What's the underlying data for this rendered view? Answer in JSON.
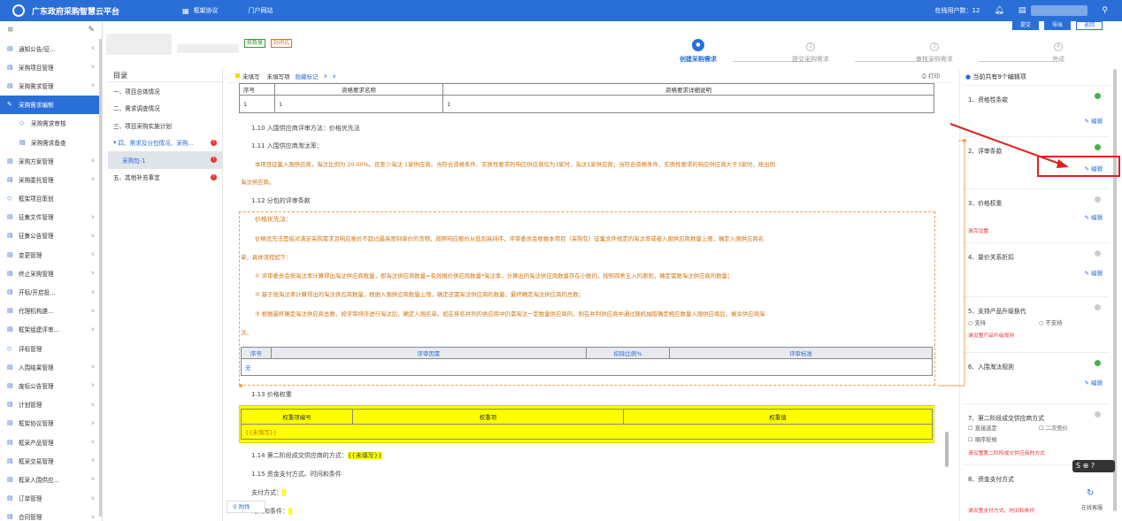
{
  "header": {
    "title": "广东政府采购智慧云平台",
    "nav": [
      {
        "icon": "grid-icon",
        "label": "框架协议"
      },
      {
        "icon": "none",
        "label": "门户网站"
      }
    ],
    "online": "在线用户数：12"
  },
  "sidebar": {
    "items": [
      {
        "label": "通知公告/征...",
        "icon": "doc-icon"
      },
      {
        "label": "采购项目管理",
        "icon": "doc-icon"
      },
      {
        "label": "采购需求管理",
        "icon": "doc-icon"
      },
      {
        "label": "采购需求编制",
        "icon": "edit-icon",
        "active": true
      },
      {
        "label": "采购需求审核",
        "icon": "diamond-icon"
      },
      {
        "label": "采购需求备查",
        "icon": "doc-icon"
      },
      {
        "label": "采购方案管理",
        "icon": "doc-icon"
      },
      {
        "label": "采购委托管理",
        "icon": "doc-icon"
      },
      {
        "label": "框架项目策划",
        "icon": "diamond-icon"
      },
      {
        "label": "征集文件管理",
        "icon": "doc-icon"
      },
      {
        "label": "征集公告管理",
        "icon": "doc-icon"
      },
      {
        "label": "变更管理",
        "icon": "doc-icon"
      },
      {
        "label": "终止采购管理",
        "icon": "doc-icon"
      },
      {
        "label": "开标/开启投...",
        "icon": "doc-icon"
      },
      {
        "label": "代理机构遴...",
        "icon": "doc-icon"
      },
      {
        "label": "框架组建评审...",
        "icon": "doc-icon"
      },
      {
        "label": "评标管理",
        "icon": "diamond-icon"
      },
      {
        "label": "入围结果管理",
        "icon": "doc-icon"
      },
      {
        "label": "废标公告管理",
        "icon": "doc-icon"
      },
      {
        "label": "计划管理",
        "icon": "doc-icon"
      },
      {
        "label": "框架协议管理",
        "icon": "doc-icon"
      },
      {
        "label": "框采产品管理",
        "icon": "doc-icon"
      },
      {
        "label": "框采交易管理",
        "icon": "doc-icon"
      },
      {
        "label": "框采入围供应...",
        "icon": "doc-icon"
      },
      {
        "label": "订单管理",
        "icon": "doc-icon"
      },
      {
        "label": "合同管理",
        "icon": "doc-icon"
      }
    ]
  },
  "page": {
    "tags": [
      "按数量",
      "封闭式"
    ],
    "buttons": [
      "提交",
      "导出",
      "返回"
    ],
    "steps": [
      {
        "n": "1",
        "label": "创建采购需求"
      },
      {
        "n": "2",
        "label": "提交采购需求"
      },
      {
        "n": "3",
        "label": "审核采购需求"
      },
      {
        "n": "4",
        "label": "完成"
      }
    ]
  },
  "toc": {
    "title": "目录",
    "items": [
      "一、项目总体情况",
      "二、需求调查情况",
      "三、项目采购实施计划",
      "四、需求及分包情况、采购...",
      "采购包-1",
      "五、其他补充事宜"
    ]
  },
  "doc": {
    "legend": [
      "未填写",
      "未填写项",
      "隐藏标记"
    ],
    "print": "打印",
    "table_head": [
      "序号",
      "资格要求名称",
      "资格要求详细说明"
    ],
    "table_row": [
      "1",
      "1",
      "1"
    ],
    "l110": "1.10 入围供应商评审方法：价格优先法",
    "l111": "1.11 入围供应商淘汰率：",
    "p1a": "本项目征集入围供应商，淘汰比例为 20.00%。且至少淘汰 1家供应商。当符合资格条件、实质性要求的响应供应商仅为3家时，淘汰1家供应商；当符合资格条件、实质性要求的响应供应商大于3家时，按出例",
    "p1b": "淘汰供应商。",
    "l112": "1.12 分包的评审条款",
    "d1": "价格优先法：",
    "d2a": "价格优先法是指对满足采购需求且响应报价不超过最高限制单价的货物，按照响应报价从低到高排序，评审委员会根据本项目（采购包）征集文件规定的淘汰率或者入围供应商数量上限，确定入围供应商名",
    "d2b": "单，具体流程如下：",
    "d3": "① 评审委员会按淘汰率计算得出淘汰供应商数量，即淘汰供应商数量=有效报价供应商数量*淘汰率，计算出的淘汰供应商数量存在小数的，按照四舍五入的原则，确定需要淘汰供应商的数量；",
    "d4": "② 基于按淘汰率计算得出的淘汰供应商数量，根据入围供应商数量上限，确定还需淘汰供应商的数量，最终确定淘汰供应商的总数；",
    "d5a": "③ 根据最终确定淘汰供应商总数，按评审排序进行淘汰后，确定入围名单。如在排名并列的供应商中仍需淘汰一定数量供应商的，则在并列供应商中通过随机抽取确定相应数量入围供应商后，剩余供应商淘",
    "d5b": "汰。",
    "t2head": [
      "序号",
      "评审因素",
      "扣除比例%",
      "评审标准"
    ],
    "t2row": "无",
    "l113": "1.13 价格权重",
    "t3head": [
      "权重项编号",
      "权重项",
      "权重值"
    ],
    "t3row": "{{未填写}}",
    "l114": "1.14 第二阶段成交供应商的方式：",
    "l114v": "{{未填写}}",
    "l115": "1.15 资金支付方式、时间和条件",
    "pay": "支付方式：",
    "cond": "时间和条件：",
    "attach": "附件"
  },
  "panel": {
    "head": "当前共有9个编辑项",
    "cards": [
      {
        "t": "1、资格性条款",
        "edit": "编辑"
      },
      {
        "t": "2、评审条款",
        "edit": "编辑"
      },
      {
        "t": "3、价格权重",
        "edit": "编辑",
        "warn": "请完设置"
      },
      {
        "t": "4、量价关系折扣",
        "edit": "编辑"
      },
      {
        "t": "5、支持产品升级换代",
        "o1": "支持",
        "o2": "不支持",
        "warn": "请设置产品升级规则"
      },
      {
        "t": "6、入围淘汰规则",
        "edit": "编辑"
      },
      {
        "t": "7、第二阶段成交供应商方式",
        "o1": "直接选定",
        "o2": "二次竞价",
        "o3": "顺序轮候",
        "warn": "请设置第二阶段成交供应商的方式"
      },
      {
        "t": "8、资金支付方式",
        "warn": "请设置支付方式、时间和条件"
      }
    ]
  },
  "float": {
    "service": "在线客服"
  }
}
